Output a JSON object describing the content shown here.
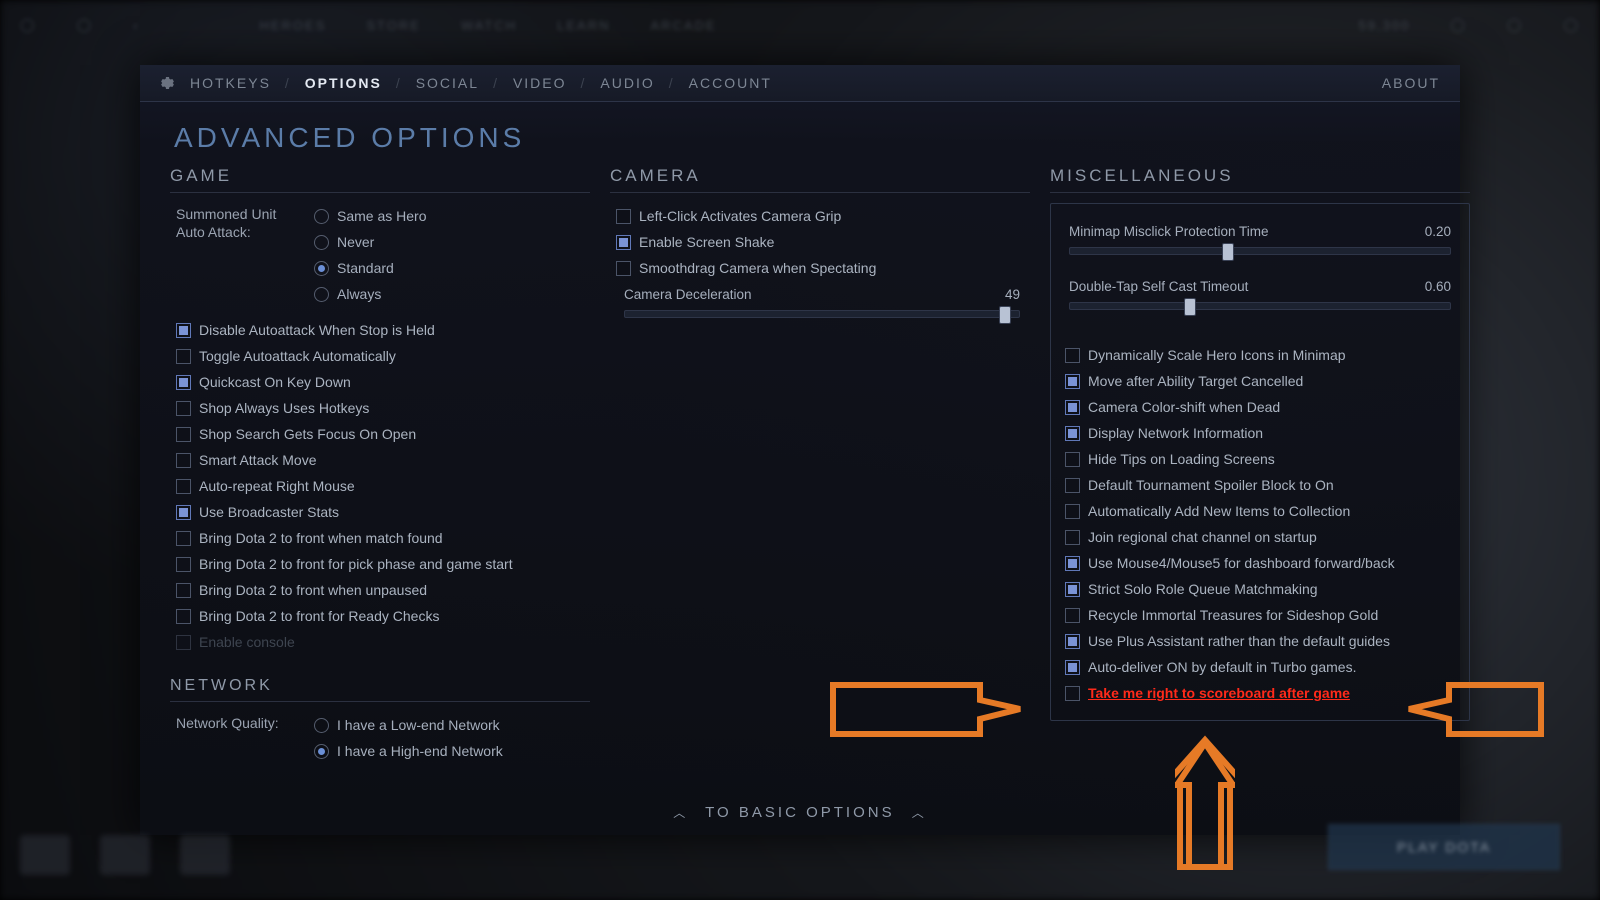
{
  "topbar": {
    "items": [
      "HEROES",
      "STORE",
      "WATCH",
      "LEARN",
      "ARCADE"
    ],
    "balance": "59,300"
  },
  "tabs": {
    "items": [
      "HOTKEYS",
      "OPTIONS",
      "SOCIAL",
      "VIDEO",
      "AUDIO",
      "ACCOUNT"
    ],
    "active": "OPTIONS",
    "about": "ABOUT"
  },
  "page_title": "ADVANCED OPTIONS",
  "game": {
    "title": "GAME",
    "summoned_label": "Summoned Unit Auto Attack:",
    "summoned_opts": [
      "Same as Hero",
      "Never",
      "Standard",
      "Always"
    ],
    "summoned_selected": "Standard",
    "checks": [
      {
        "label": "Disable Autoattack When Stop is Held",
        "checked": true
      },
      {
        "label": "Toggle Autoattack Automatically",
        "checked": false
      },
      {
        "label": "Quickcast On Key Down",
        "checked": true
      },
      {
        "label": "Shop Always Uses Hotkeys",
        "checked": false
      },
      {
        "label": "Shop Search Gets Focus On Open",
        "checked": false
      },
      {
        "label": "Smart Attack Move",
        "checked": false
      },
      {
        "label": "Auto-repeat Right Mouse",
        "checked": false
      },
      {
        "label": "Use Broadcaster Stats",
        "checked": true
      },
      {
        "label": "Bring Dota 2 to front when match found",
        "checked": false
      },
      {
        "label": "Bring Dota 2 to front for pick phase and game start",
        "checked": false
      },
      {
        "label": "Bring Dota 2 to front when unpaused",
        "checked": false
      },
      {
        "label": "Bring Dota 2 to front for Ready Checks",
        "checked": false
      },
      {
        "label": "Enable console",
        "checked": false,
        "disabled": true
      }
    ]
  },
  "network": {
    "title": "NETWORK",
    "quality_label": "Network Quality:",
    "opts": [
      "I have a Low-end Network",
      "I have a High-end Network"
    ],
    "selected": "I have a High-end Network"
  },
  "camera": {
    "title": "CAMERA",
    "checks": [
      {
        "label": "Left-Click Activates Camera Grip",
        "checked": false
      },
      {
        "label": "Enable Screen Shake",
        "checked": true
      },
      {
        "label": "Smoothdrag Camera when Spectating",
        "checked": false
      }
    ],
    "decel_label": "Camera Deceleration",
    "decel_value": "49"
  },
  "misc": {
    "title": "MISCELLANEOUS",
    "sliders": [
      {
        "label": "Minimap Misclick Protection Time",
        "value": "0.20",
        "pos": 40
      },
      {
        "label": "Double-Tap Self Cast Timeout",
        "value": "0.60",
        "pos": 30
      }
    ],
    "checks": [
      {
        "label": "Dynamically Scale Hero Icons in Minimap",
        "checked": false
      },
      {
        "label": "Move after Ability Target Cancelled",
        "checked": true
      },
      {
        "label": "Camera Color-shift when Dead",
        "checked": true
      },
      {
        "label": "Display Network Information",
        "checked": true
      },
      {
        "label": "Hide Tips on Loading Screens",
        "checked": false
      },
      {
        "label": "Default Tournament Spoiler Block to On",
        "checked": false
      },
      {
        "label": "Automatically Add New Items to Collection",
        "checked": false
      },
      {
        "label": "Join regional chat channel on startup",
        "checked": false
      },
      {
        "label": "Use Mouse4/Mouse5 for dashboard forward/back",
        "checked": true
      },
      {
        "label": "Strict Solo Role Queue Matchmaking",
        "checked": true
      },
      {
        "label": "Recycle Immortal Treasures for Sideshop Gold",
        "checked": false
      },
      {
        "label": "Use Plus Assistant rather than the default guides",
        "checked": true
      },
      {
        "label": "Auto-deliver ON by default in Turbo games.",
        "checked": true
      },
      {
        "label": "Take me right to scoreboard after game",
        "checked": false,
        "highlight": true
      }
    ]
  },
  "bottom_link": "TO BASIC OPTIONS",
  "play_button": "PLAY DOTA"
}
